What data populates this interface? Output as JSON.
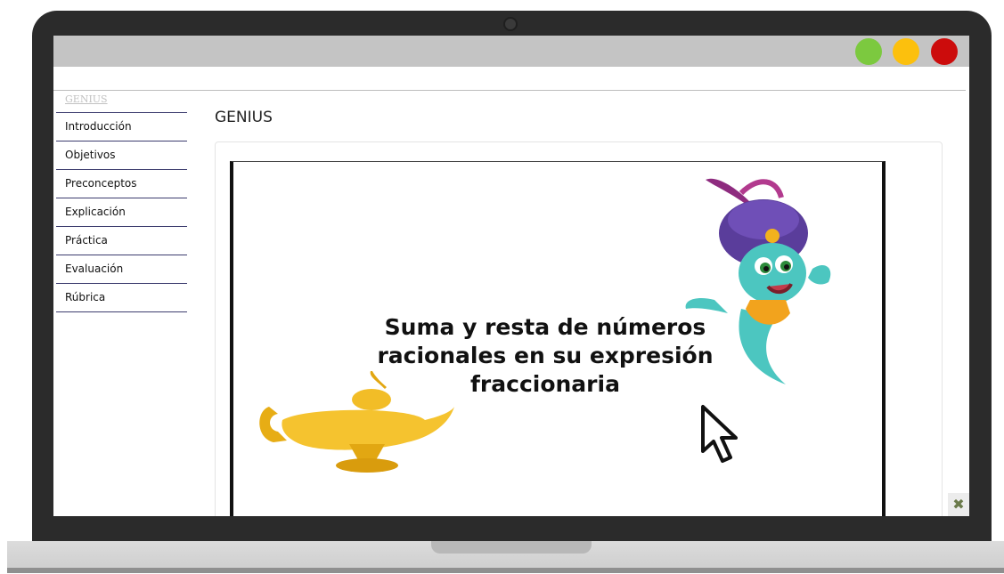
{
  "window": {
    "controls": [
      "green",
      "yellow",
      "red"
    ],
    "colors": {
      "green": "#7cc93f",
      "yellow": "#fcc00d",
      "red": "#cc0c0c"
    }
  },
  "sidebar": {
    "header": "GENIUS",
    "items": [
      {
        "label": "Introducción"
      },
      {
        "label": "Objetivos"
      },
      {
        "label": "Preconceptos"
      },
      {
        "label": "Explicación"
      },
      {
        "label": "Práctica"
      },
      {
        "label": "Evaluación"
      },
      {
        "label": "Rúbrica"
      }
    ]
  },
  "main": {
    "title": "GENIUS",
    "slide": {
      "title_lines": [
        "Suma y resta de números",
        "racionales en su expresión",
        "fraccionaria"
      ],
      "images": [
        "magic-lamp",
        "genie-character",
        "pointer-cursor"
      ]
    }
  },
  "icons": {
    "corner": "tools-icon"
  }
}
